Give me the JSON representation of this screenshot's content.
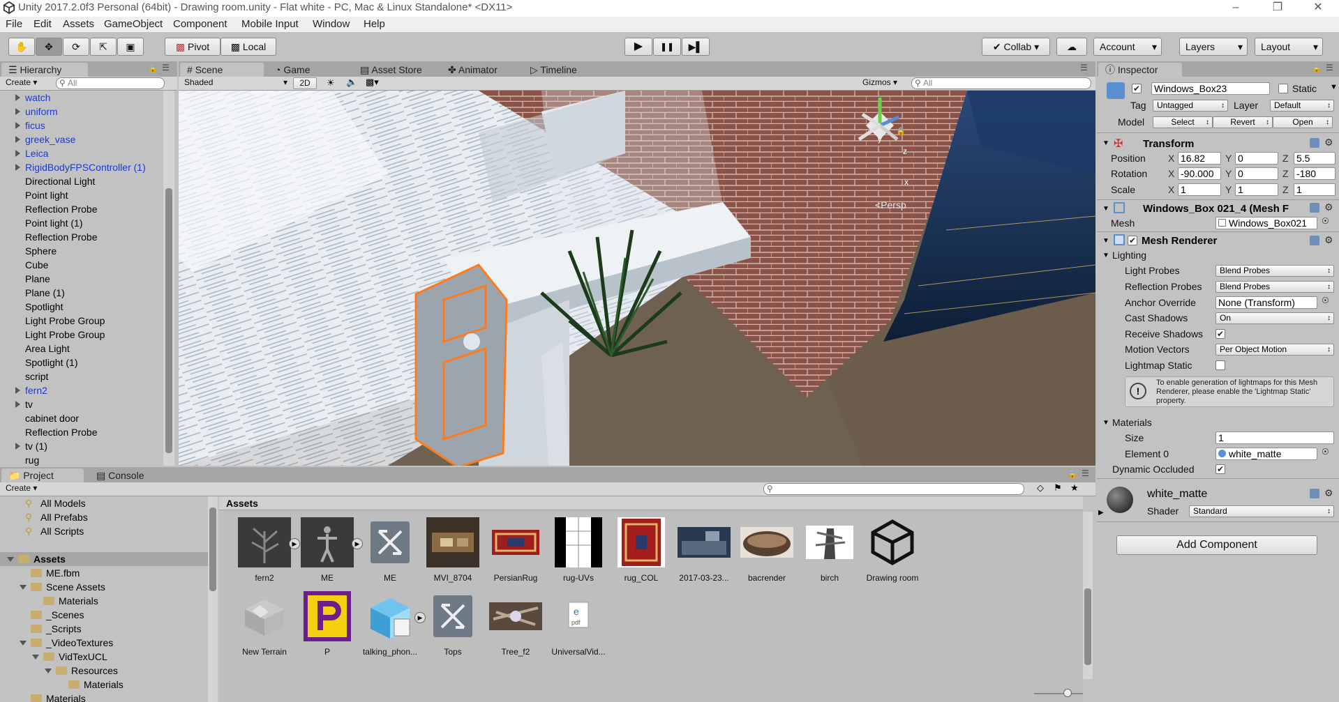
{
  "window": {
    "title": "Unity 2017.2.0f3 Personal (64bit) - Drawing room.unity - Flat white - PC, Mac & Linux Standalone* <DX11>",
    "minimize": "–",
    "maximize": "❐",
    "close": "✕"
  },
  "menubar": [
    "File",
    "Edit",
    "Assets",
    "GameObject",
    "Component",
    "Mobile Input",
    "Window",
    "Help"
  ],
  "toolbar": {
    "pivot": "Pivot",
    "local": "Local",
    "play": "▶",
    "pause": "❚❚",
    "step": "▶▌",
    "collab": "Collab ▾",
    "account": "Account",
    "layers": "Layers",
    "layout": "Layout"
  },
  "hierarchy": {
    "tab": "Hierarchy",
    "create": "Create ▾",
    "search_placeholder": "All",
    "items": [
      {
        "label": "watch",
        "blue": true,
        "expand": true
      },
      {
        "label": "uniform",
        "blue": true,
        "expand": true
      },
      {
        "label": "ficus",
        "blue": true,
        "expand": true
      },
      {
        "label": "greek_vase",
        "blue": true,
        "expand": true
      },
      {
        "label": "Leica",
        "blue": true,
        "expand": true
      },
      {
        "label": "RigidBodyFPSController (1)",
        "blue": true,
        "expand": true
      },
      {
        "label": "Directional Light",
        "blue": false,
        "expand": false
      },
      {
        "label": "Point light",
        "blue": false,
        "expand": false
      },
      {
        "label": "Reflection Probe",
        "blue": false,
        "expand": false
      },
      {
        "label": "Point light (1)",
        "blue": false,
        "expand": false
      },
      {
        "label": "Reflection Probe",
        "blue": false,
        "expand": false
      },
      {
        "label": "Sphere",
        "blue": false,
        "expand": false
      },
      {
        "label": "Cube",
        "blue": false,
        "expand": false
      },
      {
        "label": "Plane",
        "blue": false,
        "expand": false
      },
      {
        "label": "Plane (1)",
        "blue": false,
        "expand": false
      },
      {
        "label": "Spotlight",
        "blue": false,
        "expand": false
      },
      {
        "label": "Light Probe Group",
        "blue": false,
        "expand": false
      },
      {
        "label": "Light Probe Group",
        "blue": false,
        "expand": false
      },
      {
        "label": "Area Light",
        "blue": false,
        "expand": false
      },
      {
        "label": "Spotlight (1)",
        "blue": false,
        "expand": false
      },
      {
        "label": "script",
        "blue": false,
        "expand": false
      },
      {
        "label": "fern2",
        "blue": true,
        "expand": true
      },
      {
        "label": "tv",
        "blue": false,
        "expand": true
      },
      {
        "label": "cabinet door",
        "blue": false,
        "expand": false
      },
      {
        "label": "Reflection Probe",
        "blue": false,
        "expand": false
      },
      {
        "label": "tv (1)",
        "blue": false,
        "expand": true
      },
      {
        "label": "rug",
        "blue": false,
        "expand": false
      }
    ]
  },
  "scene": {
    "tabs": [
      "Scene",
      "Game",
      "Asset Store",
      "Animator",
      "Timeline"
    ],
    "shading": "Shaded",
    "mode2d": "2D",
    "gizmos": "Gizmos ▾",
    "search_placeholder": "All",
    "persp": "Persp",
    "axis_y": "y",
    "axis_z": "z",
    "axis_x": "x"
  },
  "inspector": {
    "tab": "Inspector",
    "object_name": "Windows_Box23",
    "static_label": "Static",
    "tag_label": "Tag",
    "tag_value": "Untagged",
    "layer_label": "Layer",
    "layer_value": "Default",
    "model_label": "Model",
    "select": "Select",
    "revert": "Revert",
    "open": "Open",
    "transform": {
      "title": "Transform",
      "position_label": "Position",
      "rotation_label": "Rotation",
      "scale_label": "Scale",
      "px": "16.82",
      "py": "0",
      "pz": "5.5",
      "rx": "-90.000",
      "ry": "0",
      "rz": "-180",
      "sx": "1",
      "sy": "1",
      "sz": "1",
      "x": "X",
      "y": "Y",
      "z": "Z"
    },
    "meshfilter": {
      "title": "Windows_Box 021_4 (Mesh F",
      "mesh_label": "Mesh",
      "mesh_value": "Windows_Box021"
    },
    "meshrenderer": {
      "title": "Mesh Renderer",
      "lighting": "Lighting",
      "light_probes_label": "Light Probes",
      "light_probes_value": "Blend Probes",
      "reflection_probes_label": "Reflection Probes",
      "reflection_probes_value": "Blend Probes",
      "anchor_label": "Anchor Override",
      "anchor_value": "None (Transform)",
      "cast_label": "Cast Shadows",
      "cast_value": "On",
      "receive_label": "Receive Shadows",
      "motion_label": "Motion Vectors",
      "motion_value": "Per Object Motion",
      "lightmap_label": "Lightmap Static",
      "info": "To enable generation of lightmaps for this Mesh Renderer, please enable the 'Lightmap Static' property.",
      "materials": "Materials",
      "size_label": "Size",
      "size_value": "1",
      "element_label": "Element 0",
      "element_value": "white_matte",
      "dynamic_label": "Dynamic Occluded"
    },
    "material": {
      "name": "white_matte",
      "shader_label": "Shader",
      "shader_value": "Standard"
    },
    "add_component": "Add Component"
  },
  "project": {
    "tabs": [
      "Project",
      "Console"
    ],
    "create": "Create ▾",
    "favorites": [
      "All Models",
      "All Prefabs",
      "All Scripts"
    ],
    "tree": [
      {
        "label": "Assets",
        "bold": true,
        "indent": 0,
        "arrow": "down"
      },
      {
        "label": "ME.fbm",
        "indent": 1,
        "arrow": "none"
      },
      {
        "label": "Scene Assets",
        "indent": 1,
        "arrow": "down"
      },
      {
        "label": "Materials",
        "indent": 2,
        "arrow": "none"
      },
      {
        "label": "_Scenes",
        "indent": 1,
        "arrow": "none"
      },
      {
        "label": "_Scripts",
        "indent": 1,
        "arrow": "none"
      },
      {
        "label": "_VideoTextures",
        "indent": 1,
        "arrow": "down"
      },
      {
        "label": "VidTexUCL",
        "indent": 2,
        "arrow": "down"
      },
      {
        "label": "Resources",
        "indent": 3,
        "arrow": "down"
      },
      {
        "label": "Materials",
        "indent": 4,
        "arrow": "none"
      },
      {
        "label": "Materials",
        "indent": 1,
        "arrow": "none"
      }
    ],
    "assets_header": "Assets",
    "assets": [
      {
        "label": "fern2",
        "kind": "fern"
      },
      {
        "label": "ME",
        "kind": "me"
      },
      {
        "label": "ME",
        "kind": "prefab"
      },
      {
        "label": "MVI_8704",
        "kind": "room"
      },
      {
        "label": "PersianRug",
        "kind": "rug"
      },
      {
        "label": "rug-UVs",
        "kind": "uvs"
      },
      {
        "label": "rug_COL",
        "kind": "rugcol"
      },
      {
        "label": "2017-03-23...",
        "kind": "photo"
      },
      {
        "label": "bacrender",
        "kind": "bac"
      },
      {
        "label": "birch",
        "kind": "birch"
      },
      {
        "label": "Drawing room",
        "kind": "unity"
      },
      {
        "label": "New Terrain",
        "kind": "terrain"
      },
      {
        "label": "P",
        "kind": "p"
      },
      {
        "label": "talking_phon...",
        "kind": "cube"
      },
      {
        "label": "Tops",
        "kind": "prefab"
      },
      {
        "label": "Tree_f2",
        "kind": "tree"
      },
      {
        "label": "UniversalVid...",
        "kind": "pdf"
      }
    ]
  },
  "colors": {
    "accent_blue": "#1b3ad2",
    "selection_orange": "#ff7a1a",
    "unity_bg": "#c2c2c2"
  }
}
